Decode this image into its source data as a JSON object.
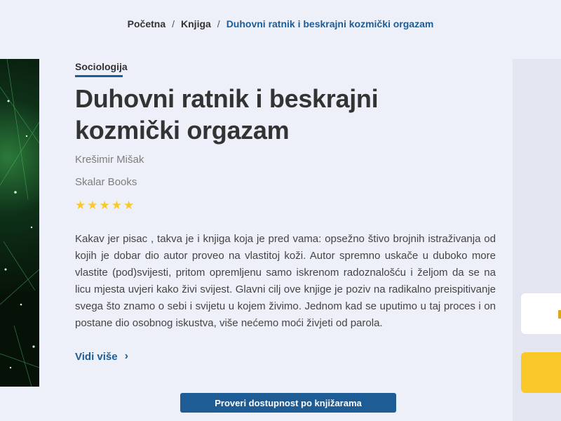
{
  "breadcrumb": {
    "home": "Početna",
    "section": "Knjiga",
    "current": "Duhovni ratnik i beskrajni kozmički orgazam",
    "separator": "/"
  },
  "book": {
    "category": "Sociologija",
    "title": "Duhovni ratnik i beskrajni kozmički orgazam",
    "author": "Krešimir Mišak",
    "publisher": "Skalar Books",
    "rating": 5,
    "description": "Kakav jer pisac , takva je i knjiga koja je pred vama: opsežno štivo brojnih istraživanja od kojih je dobar dio autor proveo na vlastitoj koži. Autor spremno uskače u duboko more vlastite (pod)svijesti, pritom opremljenu samo iskrenom radoznalošću i željom da se na licu mjesta uvjeri kako živi svijest. Glavni cilj ove knjige je poziv na radikalno preispitivanje svega što znamo o sebi i svijetu u kojem živimo. Jednom kad se uputimo u taj proces i on postane dio osobnog iskustva, više nećemo moći živjeti od parola.",
    "more_label": "Vidi više",
    "more_icon": "chevron-right-icon"
  },
  "actions": {
    "check_availability": "Proveri dostupnost po knjižarama"
  },
  "colors": {
    "accent": "#1d5c94",
    "star": "#fbc82a",
    "background": "#eef0f9"
  }
}
